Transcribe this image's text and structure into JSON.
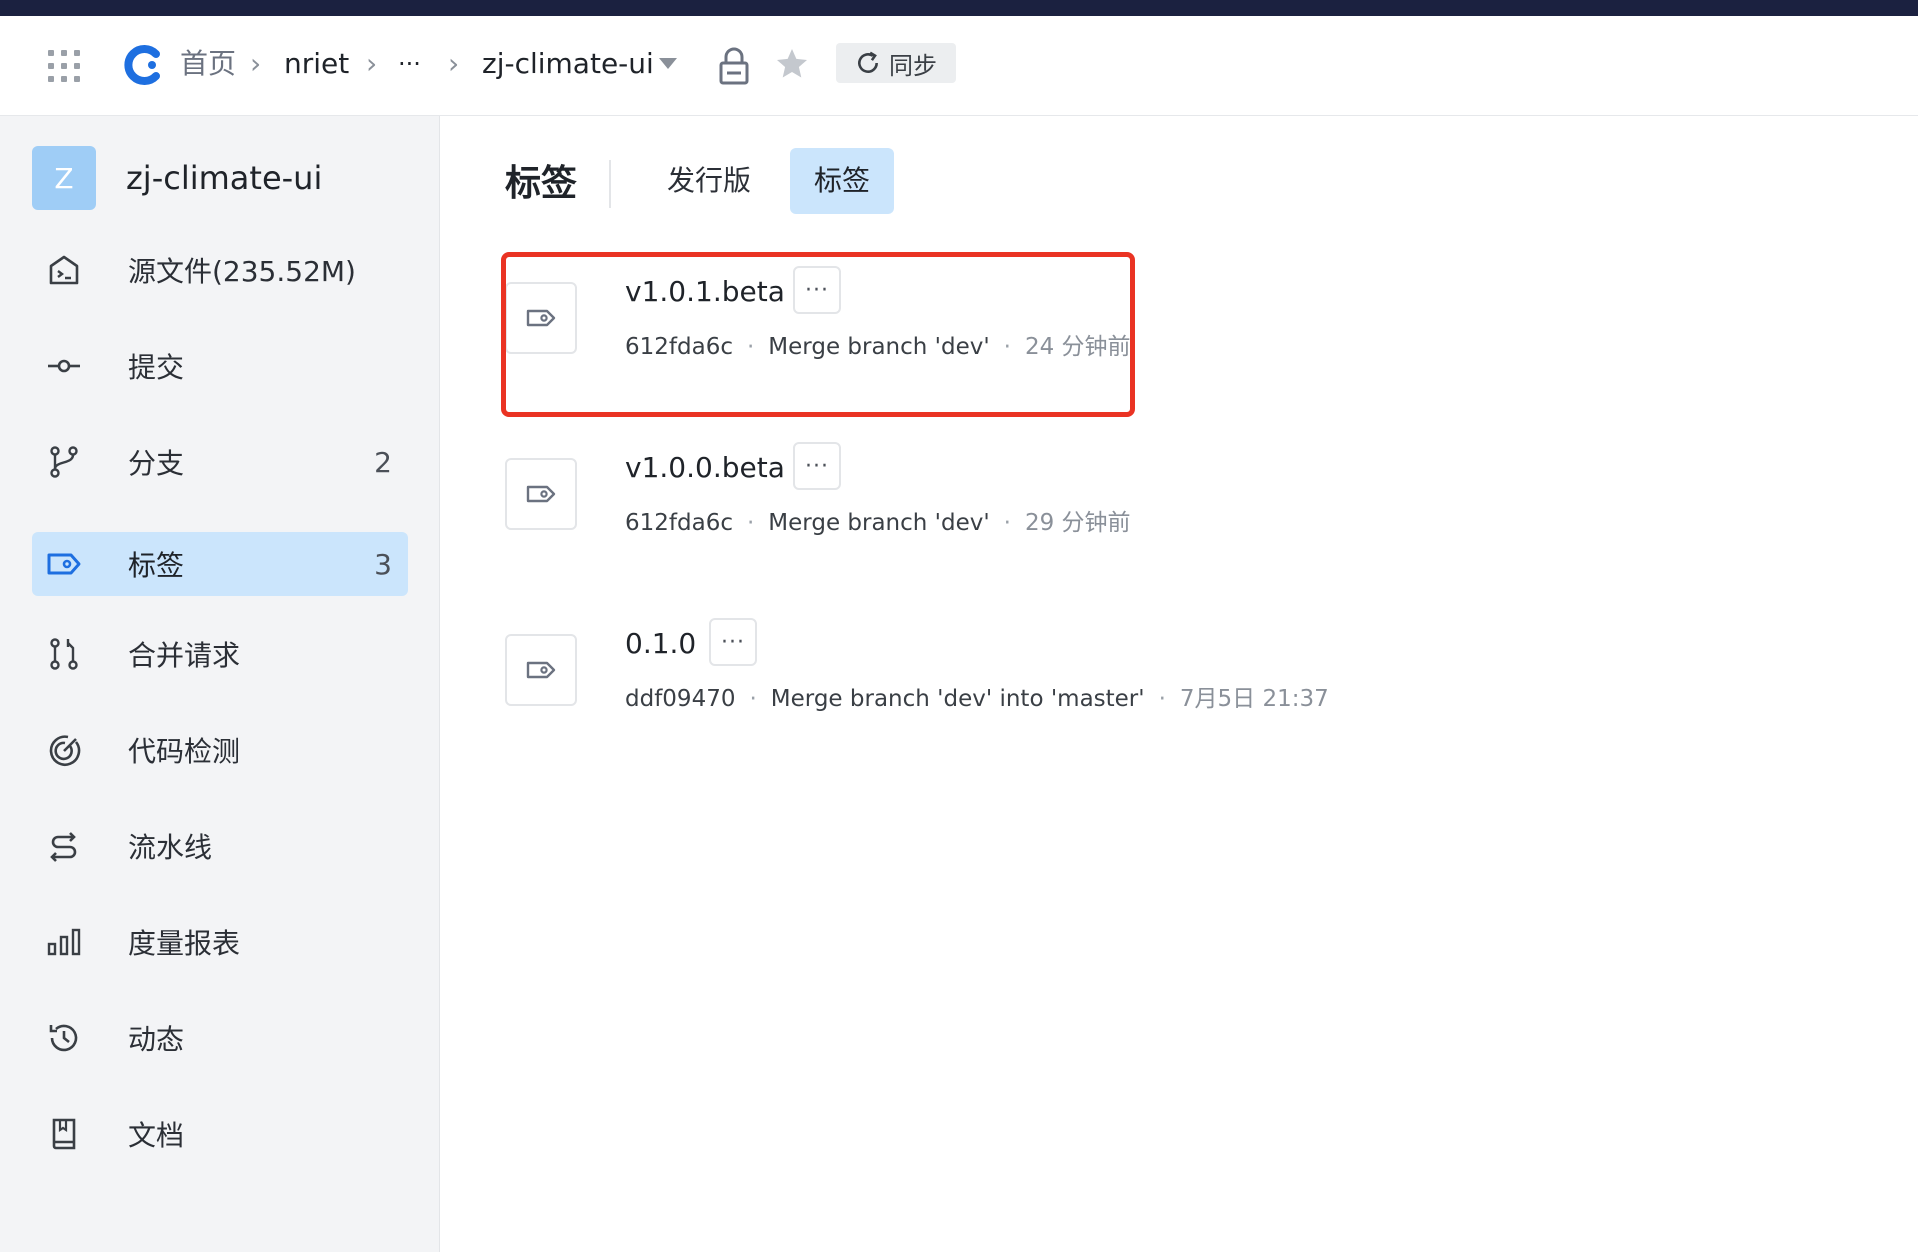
{
  "header": {
    "breadcrumb": {
      "home": "首页",
      "org": "nriet",
      "ellipsis": "···",
      "repo": "zj-climate-ui"
    },
    "sync_label": "同步",
    "colors": {
      "top_strip": "#1b2140",
      "logo": "#1e6fe0"
    }
  },
  "sidebar": {
    "repo_avatar_letter": "Z",
    "repo_name": "zj-climate-ui",
    "items": [
      {
        "label": "源文件(235.52M)",
        "icon": "code-folder-icon",
        "count": ""
      },
      {
        "label": "提交",
        "icon": "commit-icon",
        "count": ""
      },
      {
        "label": "分支",
        "icon": "branch-icon",
        "count": "2"
      },
      {
        "label": "标签",
        "icon": "tag-icon",
        "count": "3",
        "active": true
      },
      {
        "label": "合并请求",
        "icon": "merge-request-icon",
        "count": ""
      },
      {
        "label": "代码检测",
        "icon": "code-scan-icon",
        "count": ""
      },
      {
        "label": "流水线",
        "icon": "pipeline-icon",
        "count": ""
      },
      {
        "label": "度量报表",
        "icon": "bar-chart-icon",
        "count": ""
      },
      {
        "label": "动态",
        "icon": "history-icon",
        "count": ""
      },
      {
        "label": "文档",
        "icon": "book-icon",
        "count": ""
      }
    ]
  },
  "main": {
    "title": "标签",
    "tabs": [
      {
        "label": "发行版",
        "active": false
      },
      {
        "label": "标签",
        "active": true
      }
    ],
    "tags": [
      {
        "name": "v1.0.1.beta",
        "commit": "612fda6c",
        "message": "Merge branch 'dev'",
        "time": "24 分钟前",
        "highlighted": true
      },
      {
        "name": "v1.0.0.beta",
        "commit": "612fda6c",
        "message": "Merge branch 'dev'",
        "time": "29 分钟前",
        "highlighted": false
      },
      {
        "name": "0.1.0",
        "commit": "ddf09470",
        "message": "Merge branch 'dev' into 'master'",
        "time": "7月5日 21:37",
        "highlighted": false
      }
    ],
    "more_label": "···",
    "dot": "·",
    "colors": {
      "active_bg": "#cbe5fc",
      "highlight": "#ea3323"
    }
  }
}
